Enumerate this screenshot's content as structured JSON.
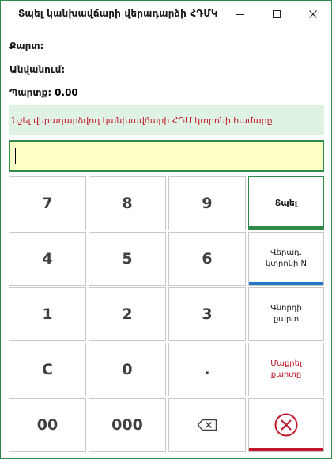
{
  "window": {
    "title": "Տպել կանխավճարի վերադարձի ՀԴՄԿ",
    "controls": {
      "minimize": "–",
      "maximize": "□",
      "close": "✕"
    }
  },
  "info": {
    "card_label": "Քարտ:",
    "name_label": "Անվանում:",
    "balance_label": "Պարտք:",
    "balance_value": "0.00"
  },
  "notice": "Նշել վերադարձվող կանխավճարի ՀԴՄ կտրոնի  համարը",
  "input": {
    "value": ""
  },
  "keypad": {
    "row1": [
      "7",
      "8",
      "9"
    ],
    "row2": [
      "4",
      "5",
      "6"
    ],
    "row3": [
      "1",
      "2",
      "3"
    ],
    "row4": [
      "C",
      "0",
      "."
    ],
    "row5": [
      "00",
      "000"
    ]
  },
  "actions": {
    "print": "Տպել",
    "receipt_no": "Վերադ.\nկտրոնի N",
    "read_card": "Գնորդի\nքարտ",
    "clear_card": "Մաքրել\nքարտը"
  },
  "icons": {
    "backspace": "backspace-icon",
    "cancel": "cancel-circle-icon"
  },
  "colors": {
    "accent_green": "#2e8a46",
    "accent_blue": "#1f78c8",
    "accent_red": "#c0182a",
    "input_bg": "#ffffc6",
    "notice_bg": "#dff2e3"
  }
}
